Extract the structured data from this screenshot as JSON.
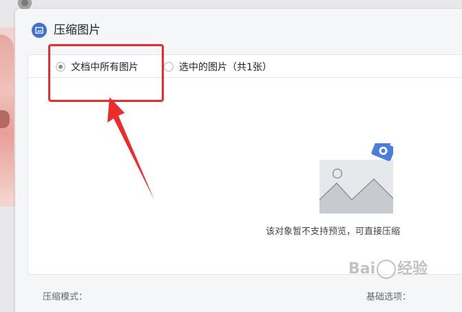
{
  "dialog": {
    "title": "压缩图片"
  },
  "scope": {
    "options": [
      {
        "label": "文档中所有图片",
        "checked": true
      },
      {
        "label": "选中的图片（共1张）",
        "checked": false
      }
    ]
  },
  "preview": {
    "message": "该对象暂不支持预览，可直接压缩"
  },
  "footer": {
    "mode_label": "压缩模式：",
    "basic_label": "基础选项："
  },
  "watermark": {
    "text_left": "Bai",
    "text_right": "经验"
  },
  "colors": {
    "accent": "#3f6fd8",
    "highlight": "#ee2b2b",
    "camera": "#4a7de0"
  }
}
